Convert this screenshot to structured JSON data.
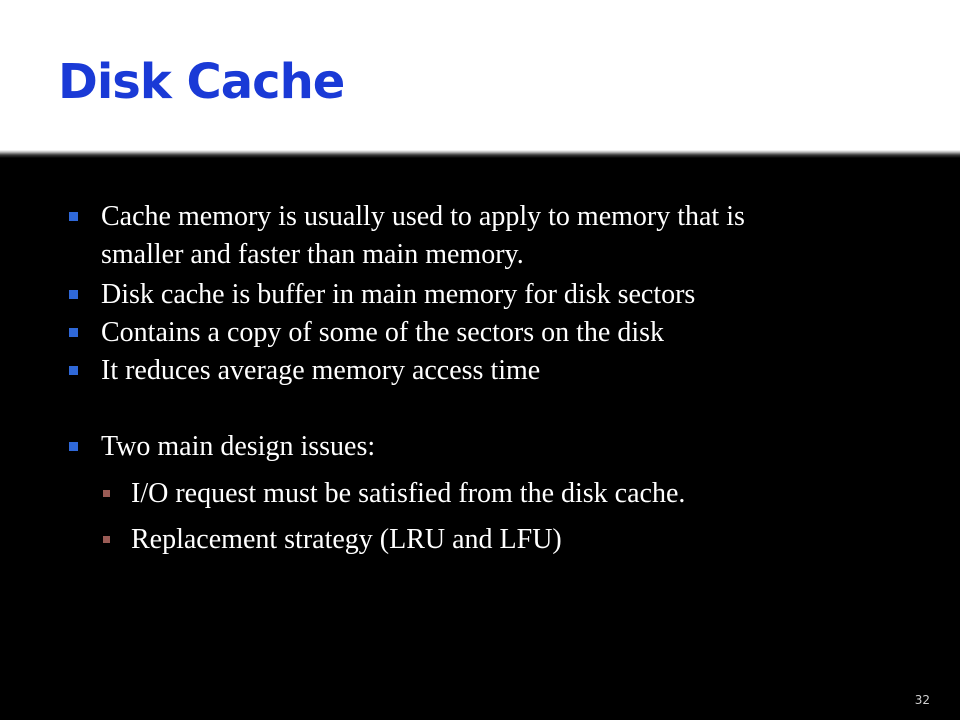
{
  "slide": {
    "title": "Disk Cache",
    "bullets": [
      {
        "line1": "Cache memory is usually used to apply to memory that is",
        "line2": "smaller and faster than main memory."
      },
      {
        "text": "Disk cache is buffer in main memory for disk sectors"
      },
      {
        "text": "Contains a copy of some of the sectors on the disk"
      },
      {
        "text": "It reduces average memory access time"
      },
      {
        "text": "Two main design issues:"
      }
    ],
    "sub_bullets": [
      {
        "text": "I/O request must be satisfied from the disk cache."
      },
      {
        "text": "Replacement strategy (LRU and LFU)"
      }
    ],
    "page_number": "32"
  },
  "colors": {
    "title": "#1a3ad6",
    "background": "#000000",
    "title_band": "#ffffff",
    "bullet_marker": "#2f68d8",
    "sub_bullet_marker": "#9a5b55"
  }
}
